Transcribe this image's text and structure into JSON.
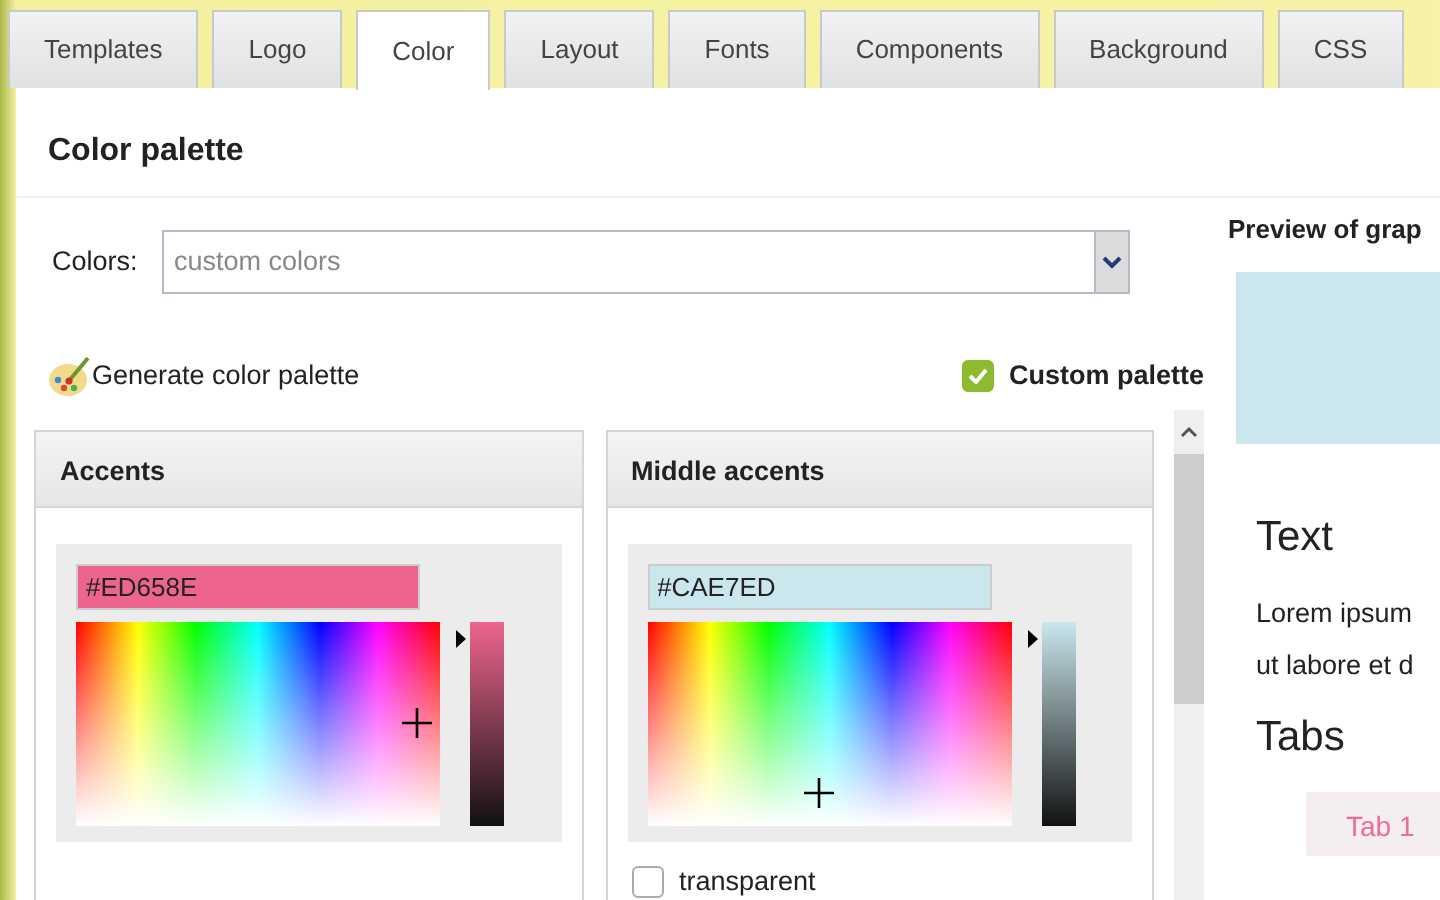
{
  "tabs": [
    {
      "label": "Templates",
      "selected": false
    },
    {
      "label": "Logo",
      "selected": false
    },
    {
      "label": "Color",
      "selected": true
    },
    {
      "label": "Layout",
      "selected": false
    },
    {
      "label": "Fonts",
      "selected": false
    },
    {
      "label": "Components",
      "selected": false
    },
    {
      "label": "Background",
      "selected": false
    },
    {
      "label": "CSS",
      "selected": false
    }
  ],
  "panel": {
    "title": "Color palette",
    "colors_label": "Colors:",
    "colors_select": {
      "placeholder": "custom colors"
    },
    "generate_button": "Generate color palette",
    "custom_palette": {
      "label": "Custom palette",
      "checked": true
    },
    "pickers": [
      {
        "title": "Accents",
        "value": "#ED658E",
        "level": 0.96
      },
      {
        "title": "Middle accents",
        "value": "#CAE7ED",
        "level": 0.96,
        "transparent": {
          "label": "transparent",
          "checked": false
        }
      }
    ]
  },
  "preview": {
    "title": "Preview of grap",
    "text_heading": "Text",
    "lorem_lines": [
      "Lorem ipsum",
      "ut labore et d"
    ],
    "tabs_heading": "Tabs",
    "tab_label": "Tab 1"
  }
}
